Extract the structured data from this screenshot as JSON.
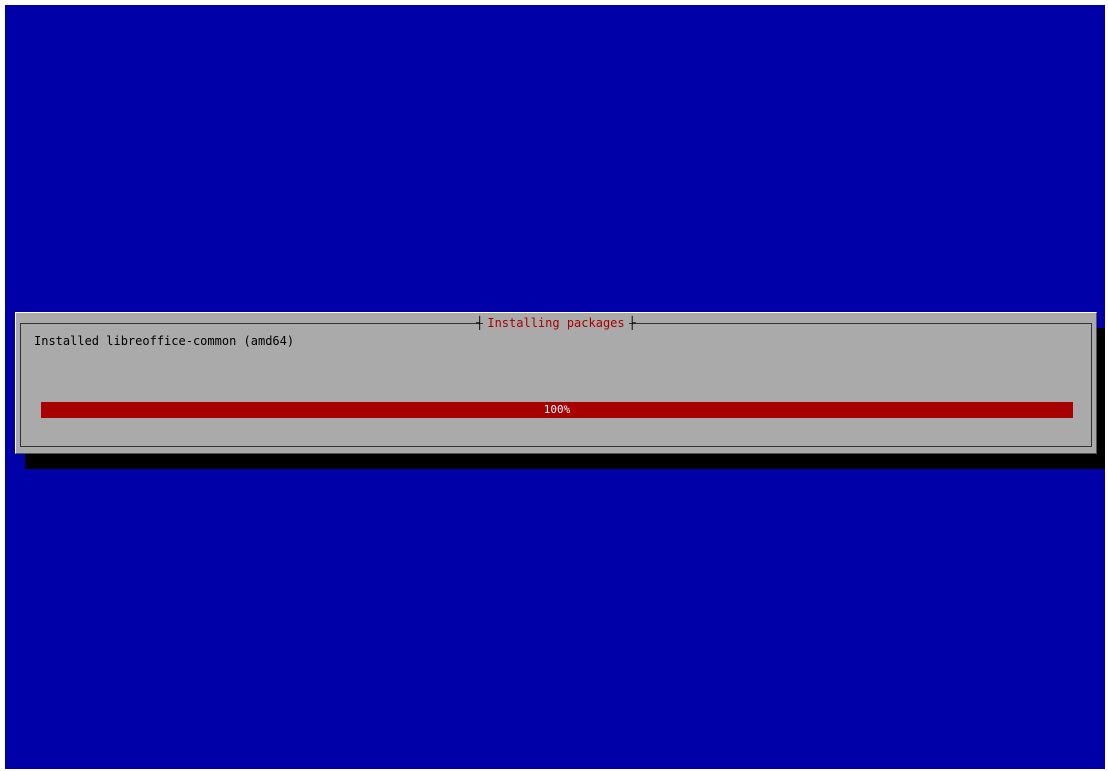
{
  "dialog": {
    "title": "Installing packages",
    "status_text": "Installed libreoffice-common (amd64)"
  },
  "progress": {
    "fraction": 1.0,
    "label": "100%"
  },
  "colors": {
    "background": "#0000a8",
    "dialog": "#aaaaaa",
    "progress_fill": "#a80000",
    "title_text": "#a80000"
  }
}
